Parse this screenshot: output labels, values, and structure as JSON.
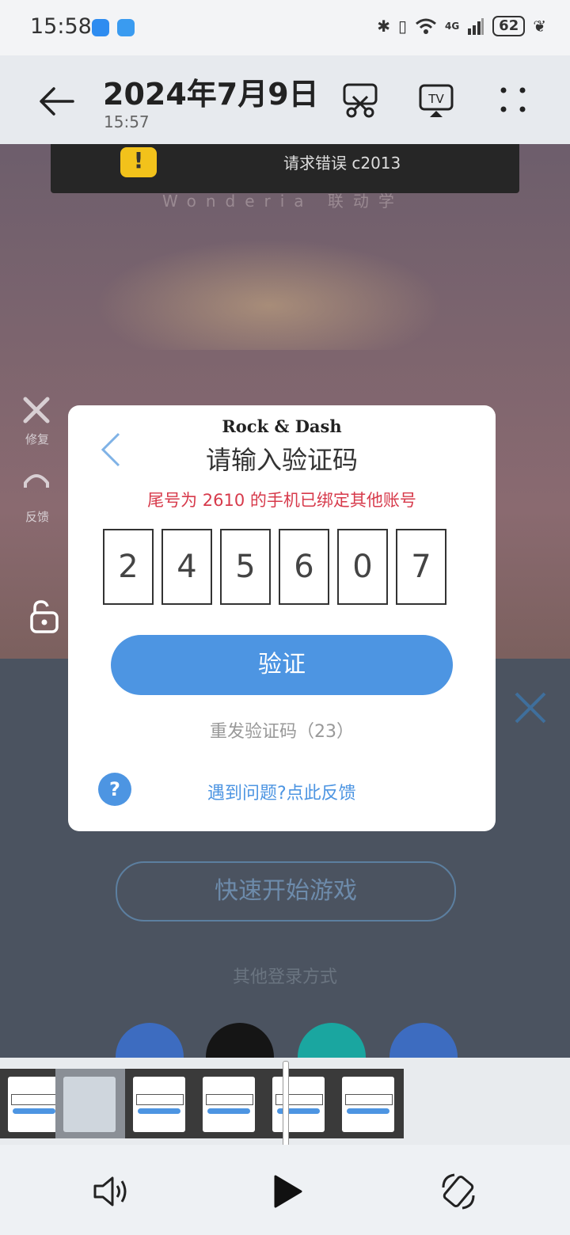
{
  "status_bar": {
    "time": "15:58",
    "network": "4G",
    "battery": "62"
  },
  "header": {
    "title": "2024年7月9日",
    "subtitle": "15:57"
  },
  "video": {
    "banner_text": "请求错误 c2013",
    "brand_faint": "Wonderia 联动学",
    "side_items": [
      "修复",
      "反馈"
    ],
    "quick_start_label": "快速开始游戏",
    "other_login_label": "其他登录方式"
  },
  "dialog": {
    "brand": "Rock & Dash",
    "title": "请输入验证码",
    "message": "尾号为 2610 的手机已绑定其他账号",
    "code_digits": [
      "2",
      "4",
      "5",
      "6",
      "0",
      "7"
    ],
    "verify_label": "验证",
    "resend_label": "重发验证码（23）",
    "help_symbol": "?",
    "feedback_label": "遇到问题?点此反馈"
  },
  "colors": {
    "accent": "#4d95e2",
    "error": "#d73a4b",
    "warning": "#f2c21b"
  }
}
